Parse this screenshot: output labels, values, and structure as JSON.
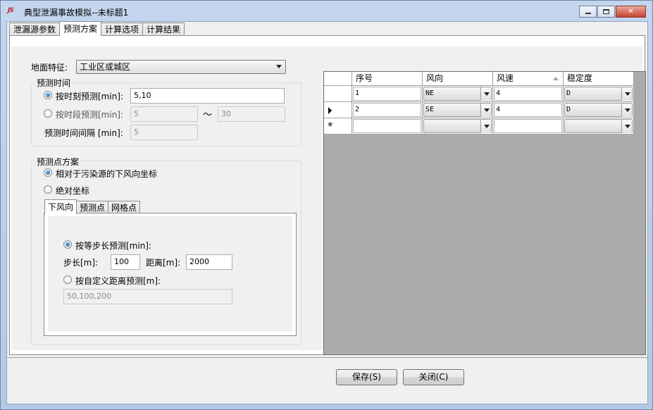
{
  "window": {
    "title": "典型泄漏事故模拟--未标题1",
    "logo": "JS",
    "controls": {
      "minimize": "▭",
      "maximize": "□",
      "close": "✕"
    }
  },
  "tabs": [
    {
      "label": "泄漏源参数"
    },
    {
      "label": "预测方案"
    },
    {
      "label": "计算选项"
    },
    {
      "label": "计算结果"
    }
  ],
  "active_tab": "预测方案",
  "ground": {
    "label": "地面特征:",
    "value": "工业区或城区"
  },
  "time": {
    "group_title": "预测时间",
    "by_moment_label": "按时刻预测[min]:",
    "by_moment_value": "5,10",
    "by_moment_selected": true,
    "by_period_label": "按时段预测[min]:",
    "by_period_from": "5",
    "by_period_tilde": "～",
    "by_period_to": "30",
    "interval_label": "预测时间间隔 [min]:",
    "interval_value": "5"
  },
  "points": {
    "group_title": "预测点方案",
    "relative_label": "相对于污染源的下风向坐标",
    "relative_selected": true,
    "absolute_label": "绝对坐标",
    "subtabs": [
      {
        "label": "下风向"
      },
      {
        "label": "预测点"
      },
      {
        "label": "网格点"
      }
    ],
    "equal_step_label": "按等步长预测[min]:",
    "equal_step_selected": true,
    "step_label": "步长[m]:",
    "step_value": "100",
    "distance_label": "距离[m]:",
    "distance_value": "2000",
    "custom_label": "按自定义距离预测[m]:",
    "custom_value": "50,100,200"
  },
  "grid": {
    "columns": [
      "序号",
      "风向",
      "风速",
      "稳定度"
    ],
    "rows": [
      {
        "no": "1",
        "dir": "NE",
        "speed": "4",
        "stability": "D"
      },
      {
        "no": "2",
        "dir": "SE",
        "speed": "4",
        "stability": "D"
      }
    ],
    "new_row_marker": "*"
  },
  "buttons": {
    "save": "保存(S)",
    "close": "关闭(C)"
  }
}
